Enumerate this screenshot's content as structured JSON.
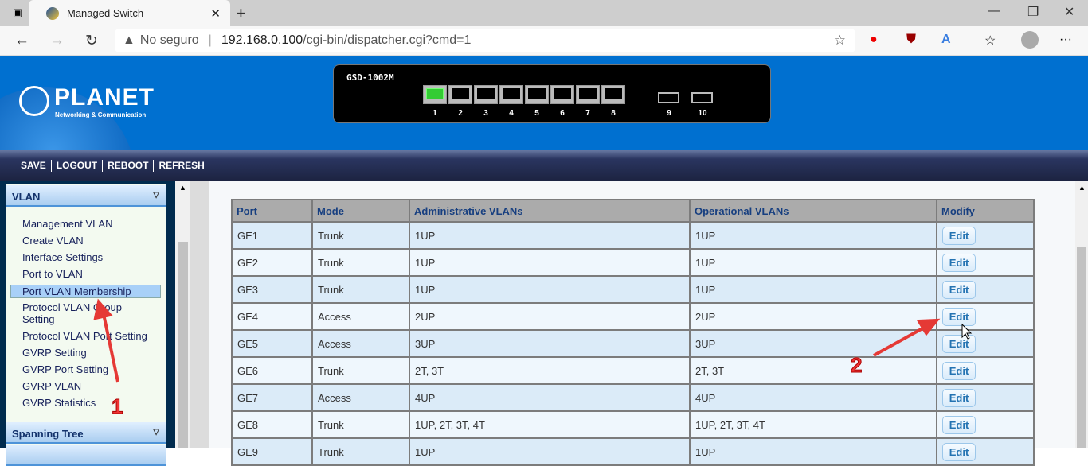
{
  "browser": {
    "tab_title": "Managed Switch",
    "security": "No seguro",
    "url_host": "192.168.0.100",
    "url_path": "/cgi-bin/dispatcher.cgi?cmd=1"
  },
  "device": {
    "model": "GSD-1002M",
    "ports": [
      "1",
      "2",
      "3",
      "4",
      "5",
      "6",
      "7",
      "8"
    ],
    "sfp_ports": [
      "9",
      "10"
    ],
    "link_up_ports": [
      "1"
    ]
  },
  "logo": {
    "name": "PLANET",
    "tagline": "Networking & Communication"
  },
  "menu": {
    "save": "SAVE",
    "logout": "LOGOUT",
    "reboot": "REBOOT",
    "refresh": "REFRESH"
  },
  "sidebar": {
    "section": "VLAN",
    "items": [
      "Management VLAN",
      "Create VLAN",
      "Interface Settings",
      "Port to VLAN",
      "Port VLAN Membership",
      "Protocol VLAN Group Setting",
      "Protocol VLAN Port Setting",
      "GVRP Setting",
      "GVRP Port Setting",
      "GVRP VLAN",
      "GVRP Statistics"
    ],
    "selected": "Port VLAN Membership",
    "next_section": "Spanning Tree"
  },
  "table": {
    "headers": [
      "Port",
      "Mode",
      "Administrative VLANs",
      "Operational VLANs",
      "Modify"
    ],
    "edit_label": "Edit",
    "rows": [
      [
        "GE1",
        "Trunk",
        "1UP",
        "1UP"
      ],
      [
        "GE2",
        "Trunk",
        "1UP",
        "1UP"
      ],
      [
        "GE3",
        "Trunk",
        "1UP",
        "1UP"
      ],
      [
        "GE4",
        "Access",
        "2UP",
        "2UP"
      ],
      [
        "GE5",
        "Access",
        "3UP",
        "3UP"
      ],
      [
        "GE6",
        "Trunk",
        "2T, 3T",
        "2T, 3T"
      ],
      [
        "GE7",
        "Access",
        "4UP",
        "4UP"
      ],
      [
        "GE8",
        "Trunk",
        "1UP, 2T, 3T, 4T",
        "1UP, 2T, 3T, 4T"
      ],
      [
        "GE9",
        "Trunk",
        "1UP",
        "1UP"
      ]
    ]
  },
  "annotations": {
    "step1": "1",
    "step2": "2",
    "color": "#e53935"
  }
}
